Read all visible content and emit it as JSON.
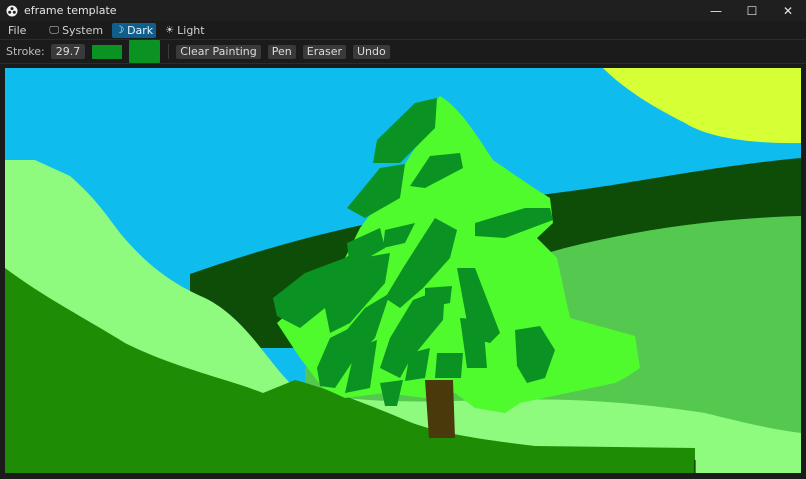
{
  "window": {
    "title": "eframe template",
    "controls": {
      "minimize": "—",
      "maximize": "☐",
      "close": "✕"
    }
  },
  "menubar": {
    "file_label": "File",
    "themes": [
      {
        "label": "System",
        "icon": "monitor-icon",
        "selected": false
      },
      {
        "label": "Dark",
        "icon": "moon-icon",
        "selected": true
      },
      {
        "label": "Light",
        "icon": "sun-icon",
        "selected": false
      }
    ]
  },
  "toolbar": {
    "stroke_label": "Stroke:",
    "stroke_width": "29.7",
    "stroke_color": "#0a9323",
    "buttons": [
      "Clear Painting",
      "Pen",
      "Eraser",
      "Undo"
    ]
  },
  "colors": {
    "sky": "#0ebdee",
    "sun": "#d6ff36",
    "dark_hill": "#0e4d08",
    "mid_hill": "#55c94f",
    "light_hill": "#8efb7f",
    "ground": "#1f8c06",
    "tree_light": "#4ffb2d",
    "tree_dark": "#0a9323",
    "trunk": "#4a3a0b"
  }
}
